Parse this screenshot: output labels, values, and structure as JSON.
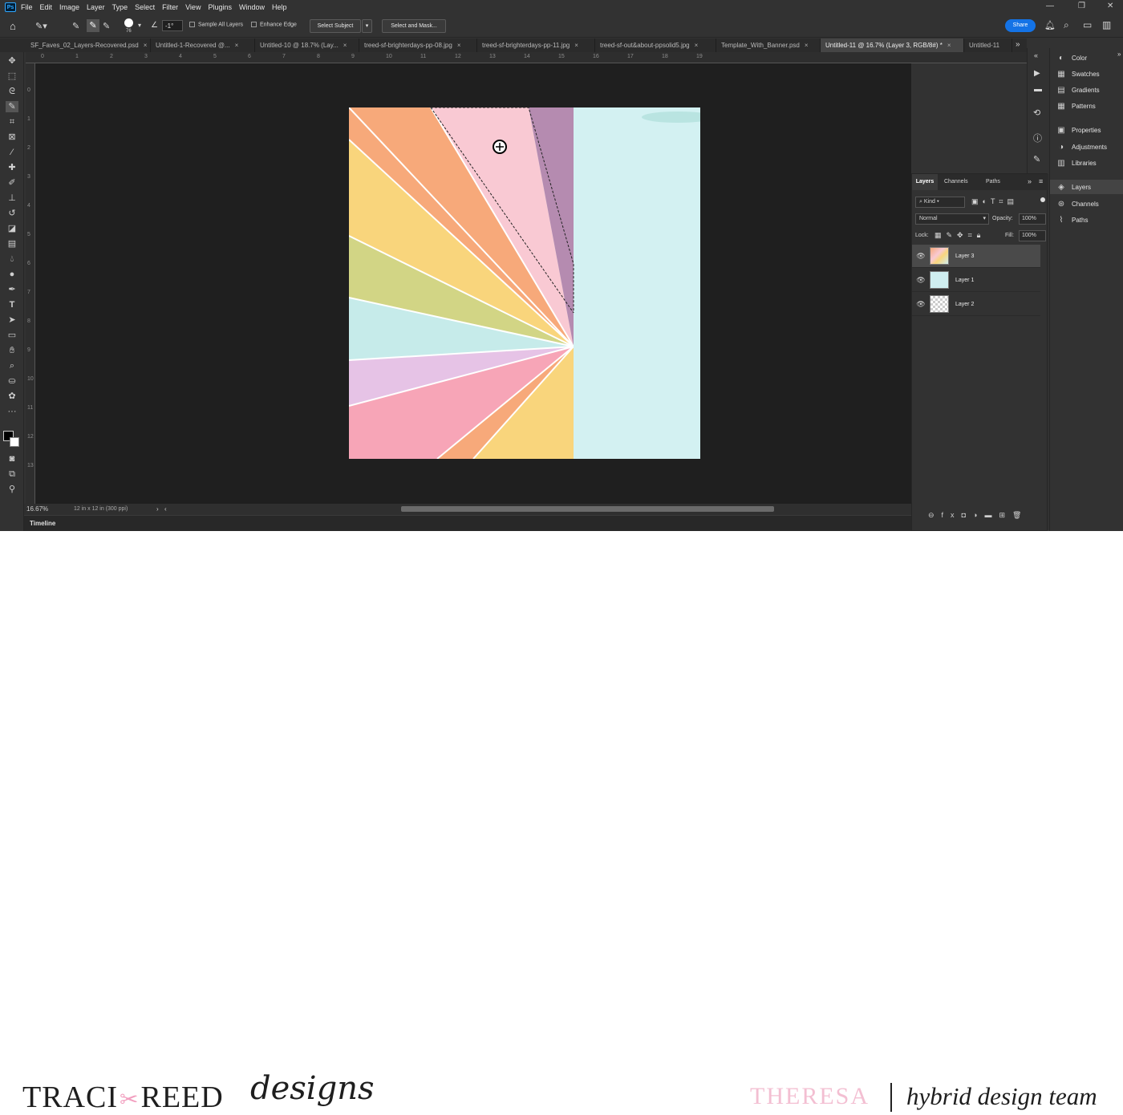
{
  "app": {
    "logo": "Ps"
  },
  "menu": [
    "File",
    "Edit",
    "Image",
    "Layer",
    "Type",
    "Select",
    "Filter",
    "View",
    "Plugins",
    "Window",
    "Help"
  ],
  "options": {
    "brush_size": "76",
    "angle": "-1°",
    "sample_all_layers": "Sample All Layers",
    "enhance_edge": "Enhance Edge",
    "select_subject": "Select Subject",
    "select_and_mask": "Select and Mask...",
    "share": "Share"
  },
  "tabs": [
    "SF_Faves_02_Layers-Recovered.psd",
    "Untitled-1-Recovered @...",
    "Untitled-10 @ 18.7% (Lay...",
    "treed-sf-brighterdays-pp-08.jpg",
    "treed-sf-brighterdays-pp-11.jpg",
    "treed-sf-out&about-ppsolid5.jpg",
    "Template_With_Banner.psd",
    "Untitled-11 @ 16.7% (Layer 3, RGB/8#) *",
    "Untitled-11"
  ],
  "ruler": [
    "0",
    "1",
    "2",
    "3",
    "4",
    "5",
    "6",
    "7",
    "8",
    "9",
    "10",
    "11",
    "12",
    "13",
    "14",
    "15",
    "16",
    "17",
    "18",
    "19"
  ],
  "status": {
    "zoom": "16.67%",
    "doc_info": "12 in x 12 in (300 ppi)"
  },
  "timeline": "Timeline",
  "right_panel": [
    "Color",
    "Swatches",
    "Gradients",
    "Patterns",
    "Properties",
    "Adjustments",
    "Libraries",
    "Layers",
    "Channels",
    "Paths"
  ],
  "layers_panel": {
    "tabs": [
      "Layers",
      "Channels",
      "Paths"
    ],
    "filter": "Kind",
    "blend_mode": "Normal",
    "opacity_label": "Opacity:",
    "opacity": "100%",
    "lock_label": "Lock:",
    "fill_label": "Fill:",
    "fill": "100%",
    "layers": [
      "Layer 3",
      "Layer 1",
      "Layer 2"
    ]
  },
  "colors": {
    "accent": "#1473e6",
    "designer_pink": "#f3bfd2"
  },
  "footer": {
    "brand_a": "TRACI",
    "brand_b": "REED",
    "brand_script": "designs",
    "designer": "THERESA",
    "team": "hybrid design team"
  }
}
